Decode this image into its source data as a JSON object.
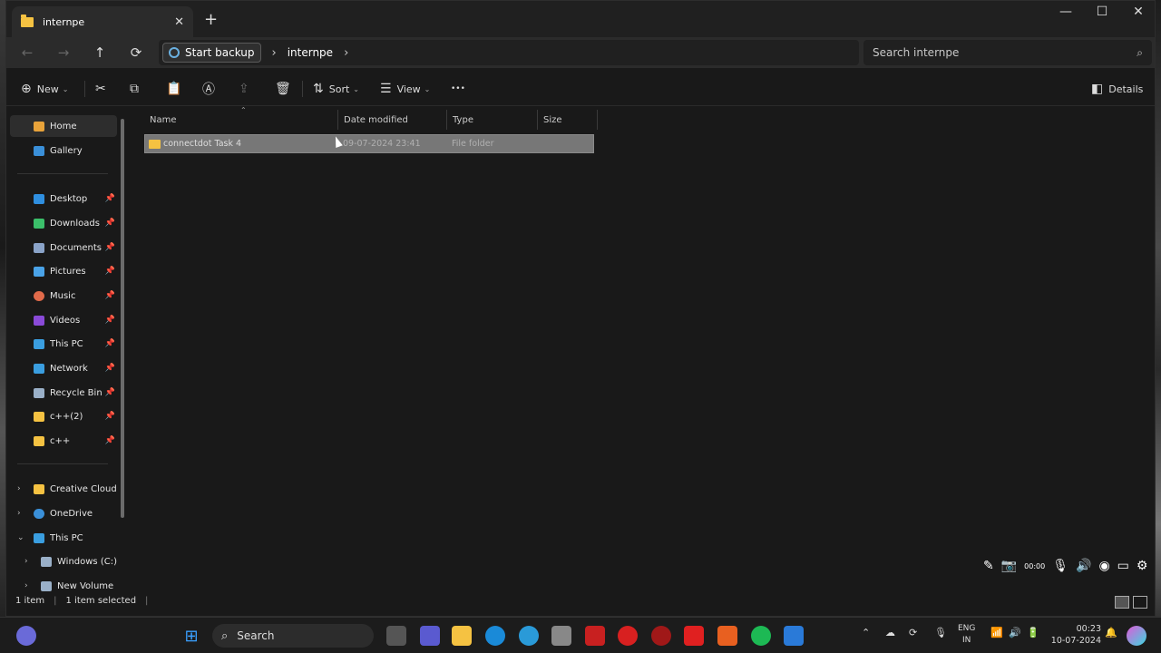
{
  "tab": {
    "title": "internpe",
    "close": "✕",
    "new": "+"
  },
  "window_controls": {
    "minimize": "—",
    "maximize": "☐",
    "close": "✕"
  },
  "nav": {
    "back": "←",
    "forward": "→",
    "up": "↑",
    "refresh": "⟳"
  },
  "address": {
    "backup_label": "Start backup",
    "sep": "›",
    "folder": "internpe"
  },
  "search": {
    "placeholder": "Search internpe",
    "icon": "⌕"
  },
  "toolbar": {
    "new_label": "New",
    "sort_label": "Sort",
    "view_label": "View",
    "more": "•••",
    "details_label": "Details"
  },
  "sidebar": {
    "items": [
      {
        "label": "Home",
        "color": "#e8a33a"
      },
      {
        "label": "Gallery",
        "color": "#3a8fd8"
      },
      {
        "label": "Desktop",
        "color": "#2f8fe0"
      },
      {
        "label": "Downloads",
        "color": "#3bbf6a"
      },
      {
        "label": "Documents",
        "color": "#8aa3c8"
      },
      {
        "label": "Pictures",
        "color": "#4aa3e8"
      },
      {
        "label": "Music",
        "color": "#e06a4a"
      },
      {
        "label": "Videos",
        "color": "#8a4ad8"
      },
      {
        "label": "This PC",
        "color": "#3a9ee0"
      },
      {
        "label": "Network",
        "color": "#3a9ee0"
      },
      {
        "label": "Recycle Bin",
        "color": "#9ab0c8"
      },
      {
        "label": "c++(2)",
        "color": "#f5c242"
      },
      {
        "label": "c++",
        "color": "#f5c242"
      },
      {
        "label": "Creative Cloud F",
        "color": "#f5c242"
      },
      {
        "label": "OneDrive",
        "color": "#3a8fd8"
      },
      {
        "label": "This PC",
        "color": "#3a9ee0"
      },
      {
        "label": "Windows (C:)",
        "color": "#9ab0c8"
      },
      {
        "label": "New Volume (I",
        "color": "#9ab0c8"
      }
    ]
  },
  "columns": {
    "name": "Name",
    "date": "Date modified",
    "type": "Type",
    "size": "Size"
  },
  "rows": [
    {
      "name": "connectdot Task 4",
      "date": "09-07-2024 23:41",
      "type": "File folder",
      "size": ""
    }
  ],
  "status": {
    "items": "1 item",
    "selected": "1 item selected",
    "sep": "|"
  },
  "taskbar": {
    "search_label": "Search",
    "lang_top": "ENG",
    "lang_bottom": "IN",
    "time": "00:23",
    "date": "10-07-2024",
    "overlay_time": "00:00"
  },
  "colors": {
    "accent": "#60cdff",
    "folder": "#f5c242",
    "selection": "#777777"
  }
}
